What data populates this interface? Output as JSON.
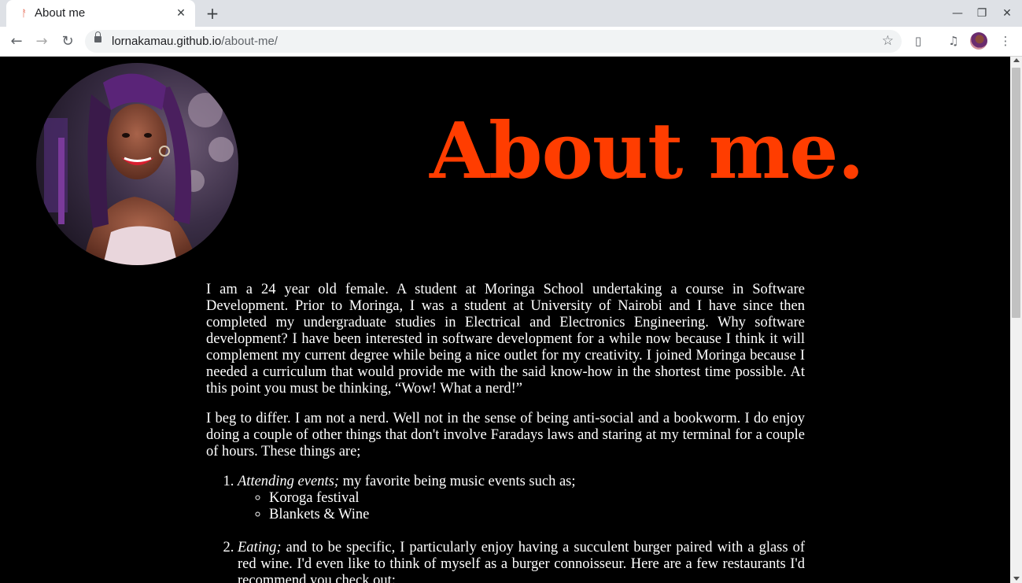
{
  "browser": {
    "tab_title": "About me",
    "tab_favicon": "ᚨ",
    "url_host": "lornakamau.github.io",
    "url_path": "/about-me/",
    "icons": {
      "close": "✕",
      "new_tab": "+",
      "minimize": "—",
      "restore": "❐",
      "window_close": "✕",
      "back": "←",
      "forward": "→",
      "reload": "↻",
      "star": "☆",
      "doc": "▯",
      "media": "♫",
      "menu": "⋮"
    }
  },
  "page": {
    "title": "About me.",
    "title_color": "#ff3d00",
    "paragraph1": "I am a 24 year old female. A student at Moringa School undertaking a course in Software Development. Prior to Moringa, I was a student at University of Nairobi and I have since then completed my undergraduate studies in Electrical and Electronics Engineering. Why software development? I have been interested in software development for a while now because I think it will complement my current degree while being a nice outlet for my creativity. I joined Moringa because I needed a curriculum that would provide me with the said know-how in the shortest time possible. At this point you must be thinking, “Wow! What a nerd!”",
    "paragraph2": "I beg to differ. I am not a nerd. Well not in the sense of being anti-social and a bookworm. I do enjoy doing a couple of other things that don't involve Faradays laws and staring at my terminal for a couple of hours. These things are;",
    "list": [
      {
        "lead": "Attending events;",
        "text": " my favorite being music events such as;",
        "sub": [
          "Koroga festival",
          "Blankets & Wine"
        ]
      },
      {
        "lead": "Eating;",
        "text": " and to be specific, I particularly enjoy having a succulent burger paired with a glass of red wine. I'd even like to think of myself as a burger connoisseur. Here are a few restaurants I'd recommend you check out:"
      }
    ]
  }
}
